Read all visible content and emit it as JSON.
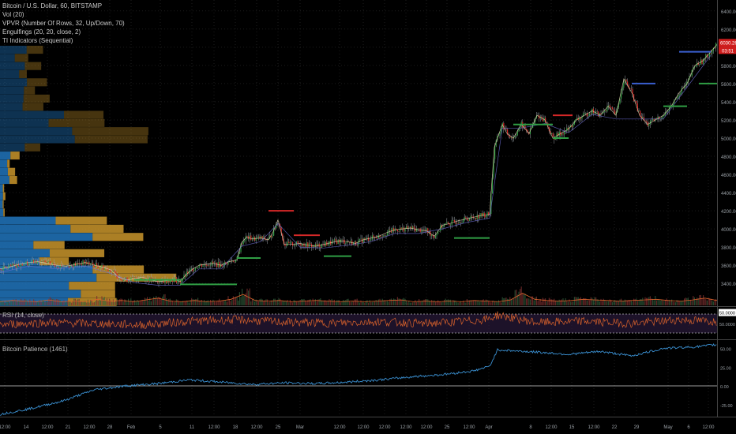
{
  "legend": {
    "symbol": "Bitcoin / U.S. Dollar, 60, BITSTAMP",
    "indicators": [
      "Vol (20)",
      "VPVR (Number Of Rows, 32, Up/Down, 70)",
      "Engulfings (20, 20, close, 2)",
      "TI Indicators (Sequential)"
    ]
  },
  "colors": {
    "background": "#000000",
    "up": "#2f9e44",
    "down": "#d62828",
    "vp_up": "#1f6fb3",
    "vp_down": "#c9952c",
    "rsi": "#d9622b",
    "patience": "#3a8fd0",
    "price_tag": "#d01c1c"
  },
  "chart_data": [
    {
      "type": "line",
      "title": "Bitcoin / U.S. Dollar, 60, BITSTAMP",
      "xlabel": "",
      "ylabel": "",
      "ylim": [
        3150,
        6450
      ],
      "y_ticks": [
        3400,
        3600,
        3800,
        4000,
        4200,
        4400,
        4600,
        4800,
        5000,
        5200,
        5400,
        5600,
        5800,
        6000,
        6200,
        6400
      ],
      "last_price": "6030.26",
      "countdown": "03:51",
      "x": [
        0,
        12,
        24,
        36,
        48,
        60,
        72,
        84,
        96,
        108,
        120,
        130,
        140,
        150,
        160,
        170,
        180,
        190,
        200,
        210,
        220,
        228,
        236,
        244,
        252,
        260,
        270,
        280,
        290,
        300,
        306,
        312,
        320,
        330,
        340,
        346,
        352,
        360,
        370,
        380,
        390,
        400,
        410,
        420,
        430,
        440,
        450,
        460,
        470,
        480,
        490,
        500,
        510,
        520,
        530,
        540,
        550,
        560,
        570,
        580,
        590,
        600,
        610,
        620,
        626,
        630,
        636,
        642,
        650,
        660,
        670,
        680,
        690,
        700,
        710,
        720,
        730,
        740,
        750,
        760,
        770,
        780,
        790,
        800,
        810,
        820,
        830,
        840,
        850,
        860,
        870,
        880,
        890,
        900,
        908
      ],
      "y": [
        3560,
        3580,
        3610,
        3630,
        3640,
        3620,
        3600,
        3590,
        3610,
        3630,
        3600,
        3580,
        3550,
        3470,
        3440,
        3450,
        3470,
        3440,
        3420,
        3430,
        3450,
        3420,
        3500,
        3560,
        3600,
        3610,
        3620,
        3600,
        3640,
        3660,
        3850,
        3910,
        3890,
        3900,
        3880,
        3970,
        4100,
        3830,
        3830,
        3840,
        3820,
        3810,
        3830,
        3850,
        3870,
        3860,
        3840,
        3880,
        3900,
        3920,
        3960,
        3990,
        4000,
        4010,
        3990,
        3980,
        3920,
        4040,
        4060,
        4090,
        4110,
        4130,
        4150,
        4160,
        4900,
        5000,
        5150,
        5050,
        5000,
        5150,
        5050,
        5250,
        5200,
        5000,
        5050,
        5100,
        5200,
        5250,
        5300,
        5250,
        5350,
        5250,
        5650,
        5500,
        5250,
        5150,
        5200,
        5250,
        5350,
        5500,
        5600,
        5800,
        5850,
        5950,
        6030
      ]
    },
    {
      "type": "bar",
      "title": "Vol (20)",
      "values": [
        0.3,
        0.4,
        0.35,
        0.3,
        0.45,
        0.3,
        0.35,
        0.3,
        0.5,
        0.35,
        0.4,
        0.3,
        0.45,
        0.6,
        0.35,
        0.3,
        0.4,
        0.3,
        0.35,
        0.5,
        0.9,
        0.4,
        0.35,
        0.4,
        0.3,
        0.35,
        0.4,
        0.35,
        0.3,
        0.35,
        0.3,
        0.35,
        0.4,
        0.45,
        0.3,
        0.35,
        0.3,
        0.35,
        0.3,
        0.4,
        0.35,
        0.3,
        0.45,
        1.0,
        0.5,
        0.4,
        0.35,
        0.4,
        0.5,
        0.45,
        0.4,
        0.35,
        0.4,
        0.45,
        0.5,
        0.4,
        0.35,
        0.45,
        0.6,
        0.4
      ]
    },
    {
      "type": "line",
      "title": "RSI (14, close)",
      "ylim": [
        20,
        80
      ],
      "y_ticks": [
        50
      ],
      "y_tick_label": "50.0000",
      "top_tag": "50.0000",
      "bands": [
        30,
        70
      ],
      "x": [
        0,
        60,
        120,
        180,
        240,
        300,
        360,
        420,
        480,
        540,
        600,
        620,
        630,
        680,
        740,
        800,
        860,
        908
      ],
      "y": [
        48,
        52,
        50,
        47,
        55,
        58,
        53,
        51,
        54,
        50,
        56,
        60,
        68,
        52,
        55,
        50,
        58,
        54
      ]
    },
    {
      "type": "line",
      "title": "Bitcoin Patience (1461)",
      "ylim": [
        -40,
        60
      ],
      "y_ticks": [
        -25,
        0,
        25,
        50
      ],
      "y_tick_labels": [
        "-25.00",
        "0.00",
        "25.00",
        "50.00"
      ],
      "x": [
        0,
        40,
        80,
        120,
        160,
        200,
        240,
        280,
        320,
        360,
        400,
        440,
        480,
        520,
        560,
        600,
        620,
        630,
        680,
        720,
        760,
        800,
        840,
        880,
        908
      ],
      "y": [
        -38,
        -30,
        -20,
        -5,
        0,
        3,
        8,
        5,
        2,
        4,
        3,
        5,
        8,
        12,
        15,
        20,
        26,
        48,
        45,
        42,
        46,
        40,
        50,
        52,
        55
      ]
    }
  ],
  "xaxis": {
    "labels": [
      {
        "x": 6,
        "t": "12:00"
      },
      {
        "x": 33,
        "t": "14"
      },
      {
        "x": 60,
        "t": "12:00"
      },
      {
        "x": 86,
        "t": "21"
      },
      {
        "x": 113,
        "t": "12:00"
      },
      {
        "x": 139,
        "t": "28"
      },
      {
        "x": 166,
        "t": "Feb"
      },
      {
        "x": 203,
        "t": "5"
      },
      {
        "x": 243,
        "t": "11"
      },
      {
        "x": 271,
        "t": "12:00"
      },
      {
        "x": 298,
        "t": "18"
      },
      {
        "x": 325,
        "t": "12:00"
      },
      {
        "x": 352,
        "t": "25"
      },
      {
        "x": 380,
        "t": "Mar"
      },
      {
        "x": 430,
        "t": "12:00"
      },
      {
        "x": 460,
        "t": "12:00"
      },
      {
        "x": 487,
        "t": "12:00"
      },
      {
        "x": 514,
        "t": "12:00"
      },
      {
        "x": 540,
        "t": "12:00"
      },
      {
        "x": 566,
        "t": "25"
      },
      {
        "x": 594,
        "t": "12:00"
      },
      {
        "x": 619,
        "t": "Apr"
      },
      {
        "x": 672,
        "t": "8"
      },
      {
        "x": 698,
        "t": "12:00"
      },
      {
        "x": 724,
        "t": "15"
      },
      {
        "x": 752,
        "t": "12:00"
      },
      {
        "x": 778,
        "t": "22"
      },
      {
        "x": 806,
        "t": "29"
      },
      {
        "x": 846,
        "t": "May"
      },
      {
        "x": 872,
        "t": "6"
      },
      {
        "x": 897,
        "t": "12:00"
      }
    ]
  }
}
